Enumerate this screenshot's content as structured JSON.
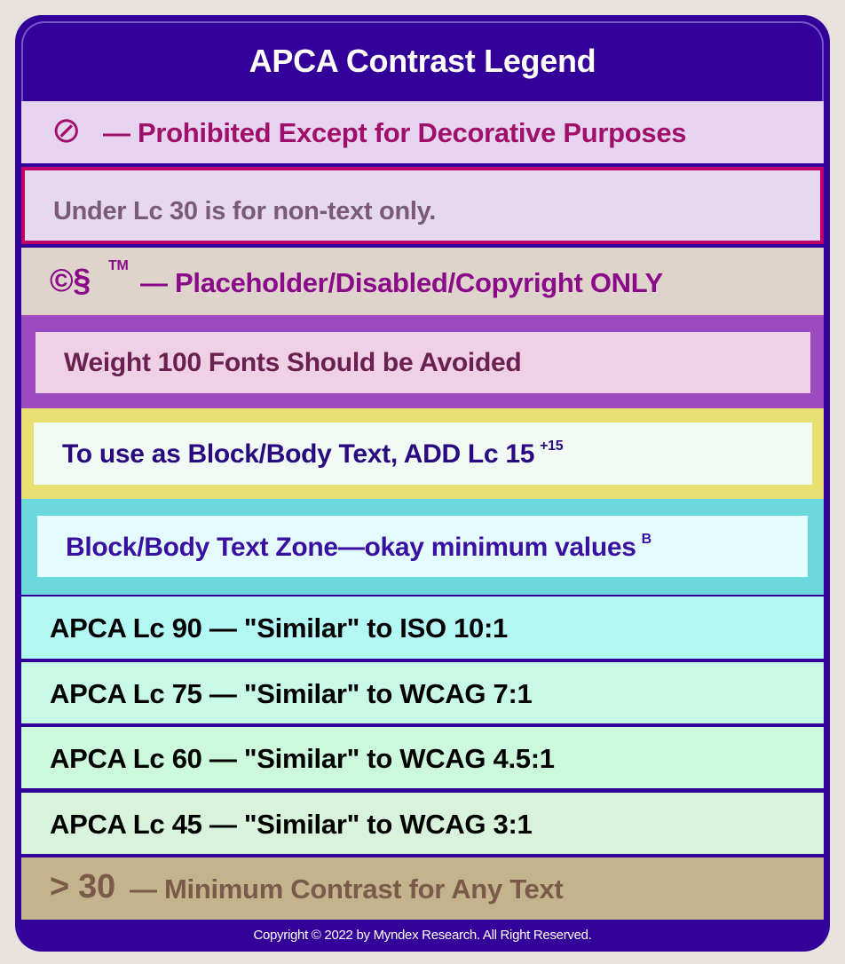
{
  "title": "APCA Contrast Legend",
  "rows": {
    "prohibited": {
      "icon": "⊘",
      "text": "— Prohibited Except for Decorative Purposes"
    },
    "under30": {
      "text": "Under Lc 30 is for non-text only."
    },
    "placeholder": {
      "symbols": "©§",
      "tm": "TM",
      "text": "— Placeholder/Disabled/Copyright ONLY"
    },
    "weight100": {
      "text": "Weight 100 Fonts Should be Avoided"
    },
    "add15": {
      "text": "To use as Block/Body Text, ADD Lc 15",
      "sup": "+15"
    },
    "bodyzone": {
      "text": "Block/Body Text Zone—okay minimum values",
      "sup": "B"
    },
    "lc90": {
      "text": "APCA Lc 90 — \"Similar\" to ISO 10:1"
    },
    "lc75": {
      "text": "APCA Lc 75 — \"Similar\" to WCAG 7:1"
    },
    "lc60": {
      "text": "APCA Lc 60 — \"Similar\" to WCAG 4.5:1"
    },
    "lc45": {
      "text": "APCA Lc 45 — \"Similar\" to WCAG 3:1"
    },
    "min30": {
      "big": "> 30",
      "text": "— Minimum Contrast for Any Text"
    }
  },
  "footer": "Copyright © 2022 by Myndex Research. All Right Reserved.",
  "colors": {
    "frame": "#330099",
    "prohibited": "#a0106a",
    "border": "#c0006a"
  }
}
